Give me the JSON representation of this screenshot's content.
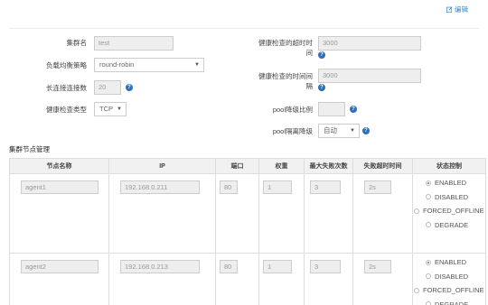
{
  "header": {
    "edit_label": "编辑"
  },
  "form": {
    "cluster_name": {
      "label": "集群名",
      "value": "test"
    },
    "lb_strategy": {
      "label": "负载均衡策略",
      "value": "round-robin"
    },
    "keepalive": {
      "label": "长连接连接数",
      "value": "20"
    },
    "health_type": {
      "label": "健康检查类型",
      "value": "TCP"
    },
    "health_timeout": {
      "label_line1": "健康检查的超时时",
      "label_line2": "间",
      "value": "3000"
    },
    "health_interval": {
      "label_line1": "健康检查的时间间",
      "label_line2": "隔",
      "value": "3000"
    },
    "pool_ratio": {
      "label": "pool降级比例",
      "value": ""
    },
    "pool_mode": {
      "label": "pool隔离降级",
      "value": "自动"
    }
  },
  "nodes_section_title": "集群节点管理",
  "table": {
    "headers": [
      "节点名称",
      "IP",
      "端口",
      "权重",
      "最大失败次数",
      "失败超时时间",
      "状态控制"
    ],
    "status_options": [
      "ENABLED",
      "DISABLED",
      "FORCED_OFFLINE",
      "DEGRADE"
    ],
    "rows": [
      {
        "name": "agent1",
        "ip": "192.168.0.211",
        "port": "80",
        "weight": "1",
        "max_fails": "3",
        "fail_timeout": "2s",
        "status": "ENABLED"
      },
      {
        "name": "agent2",
        "ip": "192.168.0.213",
        "port": "80",
        "weight": "1",
        "max_fails": "3",
        "fail_timeout": "2s",
        "status": "ENABLED"
      }
    ]
  }
}
